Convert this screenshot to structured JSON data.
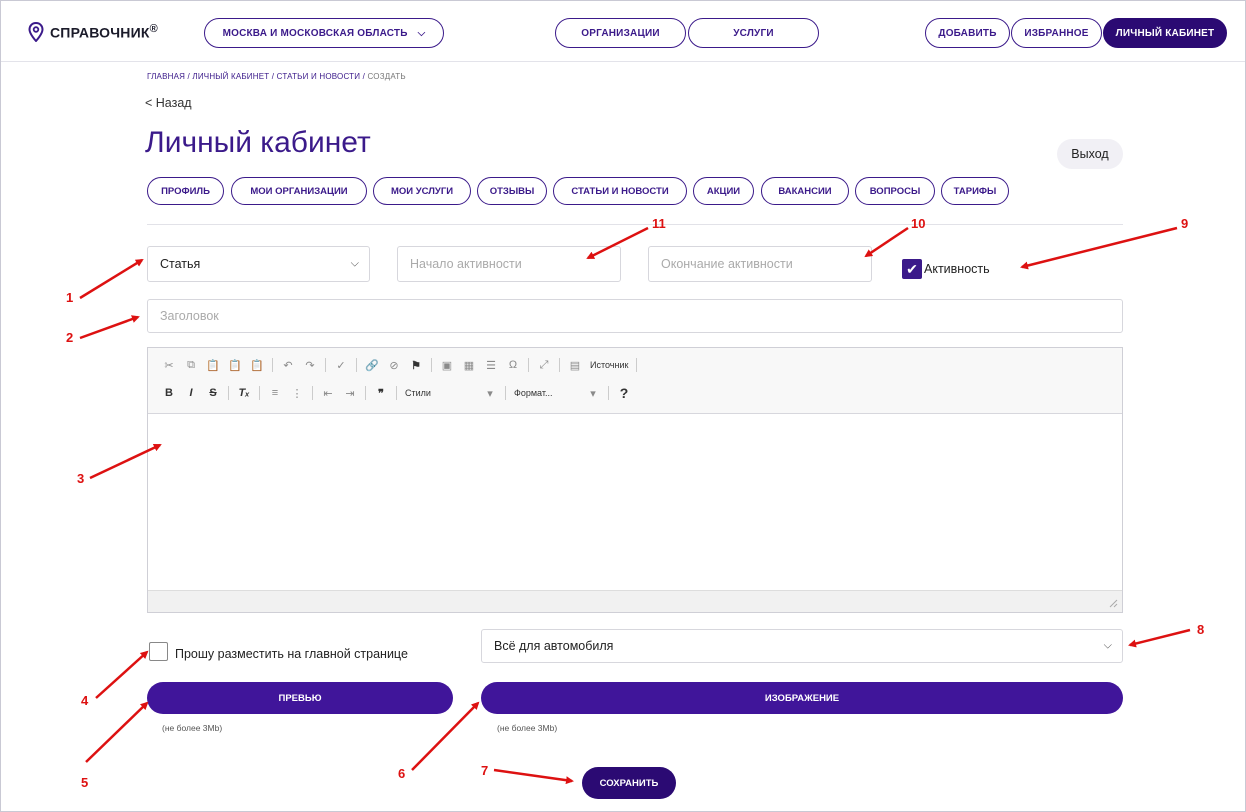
{
  "header": {
    "logo_text": "СПРАВОЧНИК",
    "logo_mark": "®",
    "region": "МОСКВА И МОСКОВСКАЯ ОБЛАСТЬ",
    "nav": [
      "ОРГАНИЗАЦИИ",
      "УСЛУГИ"
    ],
    "add": "ДОБАВИТЬ",
    "favorites": "ИЗБРАННОЕ",
    "account": "ЛИЧНЫЙ КАБИНЕТ"
  },
  "breadcrumb": {
    "items": [
      "ГЛАВНАЯ",
      "ЛИЧНЫЙ КАБИНЕТ",
      "СТАТЬИ И НОВОСТИ"
    ],
    "current": "СОЗДАТЬ"
  },
  "back_label": "< Назад",
  "page_title": "Личный кабинет",
  "logout_label": "Выход",
  "tabs": [
    "ПРОФИЛЬ",
    "МОИ ОРГАНИЗАЦИИ",
    "МОИ УСЛУГИ",
    "ОТЗЫВЫ",
    "СТАТЬИ И НОВОСТИ",
    "АКЦИИ",
    "ВАКАНСИИ",
    "ВОПРОСЫ",
    "ТАРИФЫ"
  ],
  "form": {
    "type_value": "Статья",
    "start_placeholder": "Начало активности",
    "end_placeholder": "Окончание активности",
    "active_label": "Активность",
    "active_checked": true,
    "title_placeholder": "Заголовок",
    "editor": {
      "source_label": "Источник",
      "styles_label": "Стили",
      "format_label": "Формат..."
    },
    "main_page_label": "Прошу разместить на главной странице",
    "main_page_checked": false,
    "category_value": "Всё для автомобиля",
    "preview_button": "ПРЕВЬЮ",
    "image_button": "ИЗОБРАЖЕНИЕ",
    "size_note": "(не более 3Mb)",
    "save_button": "СОХРАНИТЬ"
  },
  "annotations": [
    "1",
    "2",
    "3",
    "4",
    "5",
    "6",
    "7",
    "8",
    "9",
    "10",
    "11"
  ],
  "colors": {
    "accent": "#3b1a8a",
    "button": "#40159a",
    "annotation": "#dd1111"
  }
}
